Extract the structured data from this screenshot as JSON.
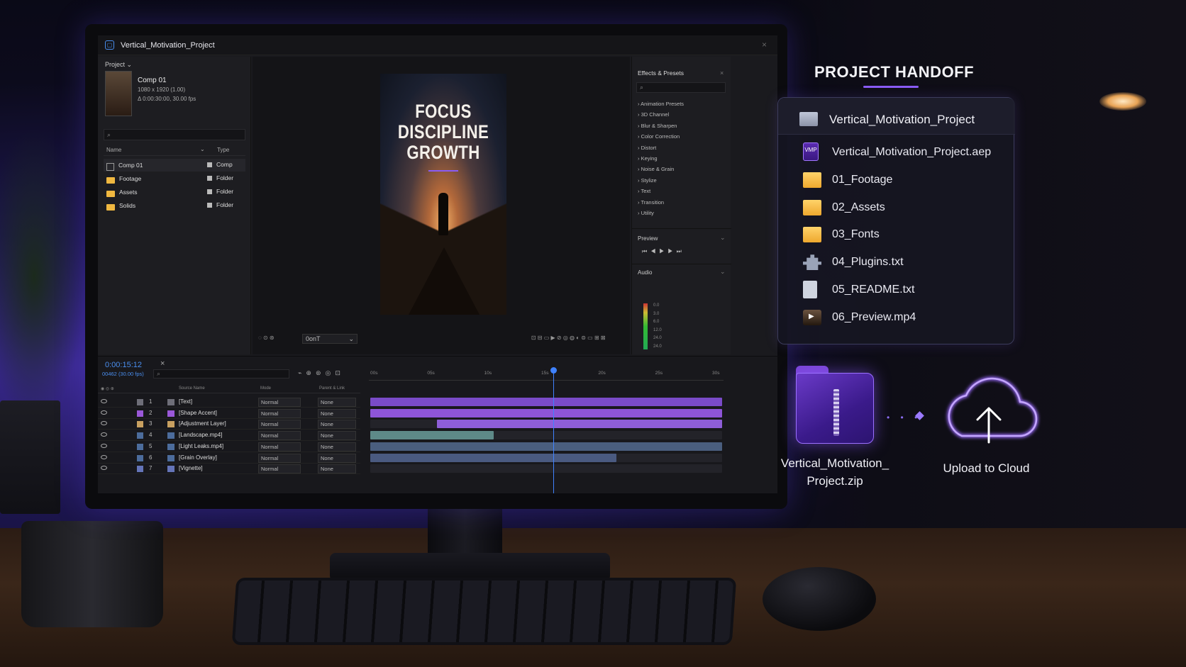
{
  "app": {
    "window_title": "Vertical_Motivation_Project",
    "project_panel": {
      "label": "Project",
      "comp_name": "Comp 01",
      "comp_size": "1080 x 1920 (1.00)",
      "comp_duration": "Δ 0:00:30:00, 30.00 fps",
      "columns": {
        "name": "Name",
        "type": "Type"
      },
      "items": [
        {
          "name": "Comp 01",
          "type": "Comp",
          "icon": "comp-icon"
        },
        {
          "name": "Footage",
          "type": "Folder",
          "icon": "folder-icon"
        },
        {
          "name": "Assets",
          "type": "Folder",
          "icon": "folder-icon"
        },
        {
          "name": "Solids",
          "type": "Folder",
          "icon": "folder-icon"
        }
      ]
    },
    "viewer": {
      "lines": [
        "FOCUS",
        "DISCIPLINE",
        "GROWTH"
      ],
      "zoom_label": "0onT"
    },
    "effects": {
      "title": "Effects & Presets",
      "categories": [
        "Animation Presets",
        "3D Channel",
        "Blur & Sharpen",
        "Color Correction",
        "Distort",
        "Keying",
        "Noise & Grain",
        "Stylize",
        "Text",
        "Transition",
        "Utility"
      ],
      "preview_label": "Preview",
      "audio_label": "Audio",
      "audio_levels": [
        "0.0",
        "3.0",
        "6.0",
        "12.0",
        "24.0",
        "24.0"
      ]
    },
    "timeline": {
      "timecode": "0:00:15:12",
      "frames": "00462 (30.00 fps)",
      "columns": {
        "source": "Source Name",
        "mode": "Mode",
        "parent": "Parent & Link"
      },
      "ruler": [
        "00s",
        "05s",
        "10s",
        "15s",
        "20s",
        "25s",
        "30s"
      ],
      "playhead_fraction": 0.52,
      "layers": [
        {
          "num": "1",
          "name": "[Text]",
          "mode": "Normal",
          "parent": "None",
          "color": "#6e6e78",
          "bar_color": "#7a4bc8",
          "start": 0.0,
          "end": 1.0
        },
        {
          "num": "2",
          "name": "[Shape Accent]",
          "mode": "Normal",
          "parent": "None",
          "color": "#9a58d8",
          "bar_color": "#8e55d8",
          "start": 0.0,
          "end": 1.0
        },
        {
          "num": "3",
          "name": "[Adjustment Layer]",
          "mode": "Normal",
          "parent": "None",
          "color": "#c8a060",
          "bar_color": "#8e5ed8",
          "start": 0.19,
          "end": 1.0
        },
        {
          "num": "4",
          "name": "[Landscape.mp4]",
          "mode": "Normal",
          "parent": "None",
          "color": "#4c6c9c",
          "bar_color": "#5e8a88",
          "start": 0.0,
          "end": 0.35
        },
        {
          "num": "5",
          "name": "[Light Leaks.mp4]",
          "mode": "Normal",
          "parent": "None",
          "color": "#4c6c9c",
          "bar_color": "#4a5e7e",
          "start": 0.0,
          "end": 1.0
        },
        {
          "num": "6",
          "name": "[Grain Overlay]",
          "mode": "Normal",
          "parent": "None",
          "color": "#4c6c9c",
          "bar_color": "#4a5a80",
          "start": 0.0,
          "end": 0.7
        },
        {
          "num": "7",
          "name": "[Vignette]",
          "mode": "Normal",
          "parent": "None",
          "color": "#6474b8",
          "bar_color": "#1c1c22",
          "start": 0.0,
          "end": 0.0
        }
      ]
    }
  },
  "handoff": {
    "title": "PROJECT HANDOFF",
    "folder_name": "Vertical_Motivation_Project",
    "files": [
      {
        "name": "Vertical_Motivation_Project.aep",
        "icon": "vmp-file-icon",
        "icon_text": "VMP"
      },
      {
        "name": "01_Footage",
        "icon": "folder-icon"
      },
      {
        "name": "02_Assets",
        "icon": "folder-icon"
      },
      {
        "name": "03_Fonts",
        "icon": "folder-icon"
      },
      {
        "name": "04_Plugins.txt",
        "icon": "puzzle-icon"
      },
      {
        "name": "05_README.txt",
        "icon": "document-icon"
      },
      {
        "name": "06_Preview.mp4",
        "icon": "video-icon"
      }
    ],
    "zip_label": [
      "Vertical_Motivation_",
      "Project.zip"
    ],
    "upload_label": "Upload to Cloud",
    "accent": "#8a5cf5"
  }
}
